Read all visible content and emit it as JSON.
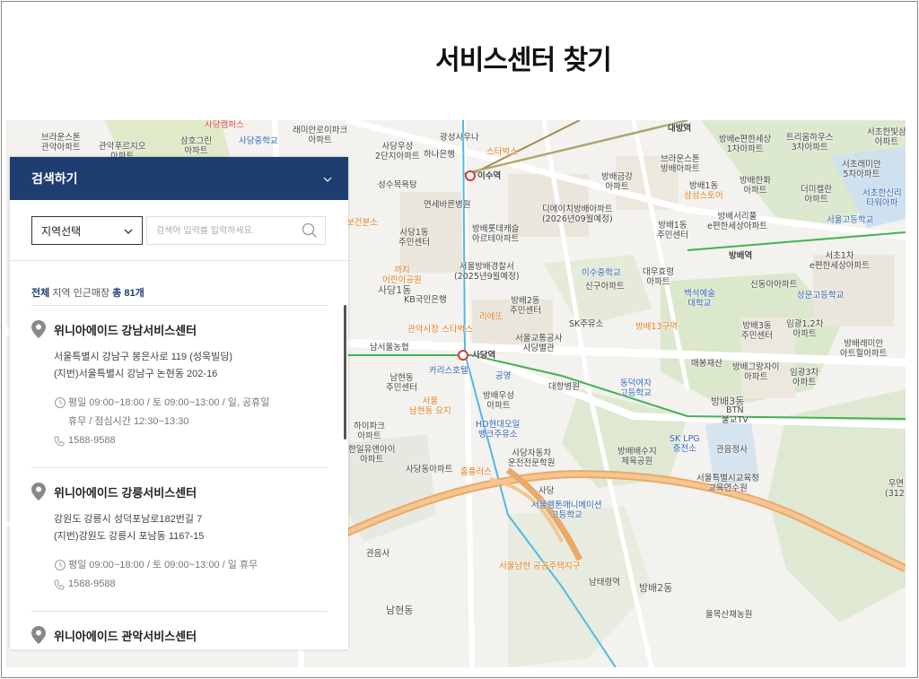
{
  "page": {
    "title": "서비스센터 찾기"
  },
  "panel": {
    "header_title": "검색하기",
    "region_select": "지역선택",
    "search_placeholder": "검색어 입력를 입력하세요.",
    "summary": {
      "prefix": "전체",
      "middle": "지역 인근매장",
      "total": "총 81개"
    },
    "stores": [
      {
        "name": "위니아에이드 강남서비스센터",
        "address": "서울특별시 강남구 봉은사로 119 (성욱빌딩)",
        "jibun": "(지번)서울특별시 강남구 논현동 202-16",
        "hours_line1": "평일 09:00~18:00 / 토 09:00~13:00 / 일, 공휴일",
        "hours_line2": "휴무 / 점심시간 12:30~13:30",
        "phone": "1588-9588"
      },
      {
        "name": "위니아에이드 강릉서비스센터",
        "address": "강원도 강릉시 성덕포남로182번길 7",
        "jibun": "(지번)강원도 강릉시 포남동 1167-15",
        "hours_line1": "평일 09:00~18:00 / 토 09:00~13:00 / 일 휴무",
        "phone": "1588-9588"
      },
      {
        "name": "위니아에이드 관악서비스센터"
      }
    ]
  },
  "map": {
    "labels": {
      "l1": "브라운스톤\n관악아파트",
      "l2": "관악푸르지오\n아파트",
      "l3": "삼호그린\n아파트",
      "l4": "사당캠퍼스",
      "l5": "사당중학교",
      "l6": "래미안로이파크\n아파트",
      "l7": "광성사우나",
      "l8": "사당우성\n2단지아파트",
      "l9": "하나은행",
      "l10": "스타벅스",
      "l11": "이수역",
      "l12": "대방역",
      "l13": "브라운스톤\n방배아파트",
      "l14": "방배e편한세상\n1차아파트",
      "l15": "트리움하우스\n3차아파트",
      "l16": "서초래미안\n5차아파트",
      "l17": "서초한빛삼\n아파트",
      "l18": "성수목욕탕",
      "l19": "연세바른병원",
      "l20": "방배금강\n아파트",
      "l21": "방배1동",
      "l22": "방배한화\n아파트",
      "l23": "더미켈란\n아파트",
      "l24": "삼성스토어",
      "l25": "서초한신리\n타워아파",
      "l26": "디에이치방배아파트\n(2026년09월예정)",
      "l27": "방배1동\n주민센터",
      "l28": "방배서리풀\ne편한세상아파트",
      "l29": "서울고등학교",
      "l30": "보건분소",
      "l31": "사당1동\n주민센터",
      "l32": "방배롯데캐슬\n아르테아파트",
      "l33": "방배역",
      "l34": "서초1차\ne편한세상아파트",
      "l35": "까치\n어린이공원",
      "l36": "서울방배경찰서\n(2025년9월예정)",
      "l37": "이수중학교",
      "l38": "대우효령\n아파트",
      "l39": "사당1동",
      "l40": "KB국민은행",
      "l41": "신구아파트",
      "l42": "백석예술\n대학교",
      "l43": "신동아아파트",
      "l44": "상문고등학교",
      "l45": "리에또",
      "l46": "방배2동\n주민센터",
      "l47": "관악시장 스타벅스",
      "l48": "SK주유소",
      "l49": "방배13구역",
      "l50": "방배3동\n주민센터",
      "l51": "임광1,2차\n아파트",
      "l52": "방배래미안\n아트힐아파트",
      "l53": "남서울농협",
      "l54": "서울교통공사\n사당별관",
      "l55": "사당역",
      "l56": "매봉재산",
      "l57": "방배그랑자이\n아파트",
      "l58": "임광3차\n아파트",
      "l59": "카리스호텔",
      "l60": "공영",
      "l61": "남현동\n주민센터",
      "l62": "대항병원",
      "l63": "동덕여자\n고등학교",
      "l64": "서울\n남현동 요지",
      "l65": "방배우성\n아파트",
      "l66": "방배3동",
      "l67": "BTN\n불교TV",
      "l68": "하이파크\n아파트",
      "l69": "HD현대오일\n뱅크주유소",
      "l70": "SK LPG\n충전소",
      "l71": "관음정사",
      "l72": "한일유앤아이\n아파트",
      "l73": "사당자동차\n운전전문학원",
      "l74": "방배배수지\n체육공원",
      "l75": "사당동아파트",
      "l76": "홈플러스",
      "l77": "서울특별시교육청\n교육연수원",
      "l78": "서울렘톤애니메이션\n고등학교",
      "l79": "관음사",
      "l80": "서울남현 공공주택지구",
      "l81": "남태령역",
      "l82": "방배2동",
      "l83": "남현동",
      "l84": "율목산채농원",
      "l85": "우면\n(312.",
      "l86": "사당"
    }
  }
}
